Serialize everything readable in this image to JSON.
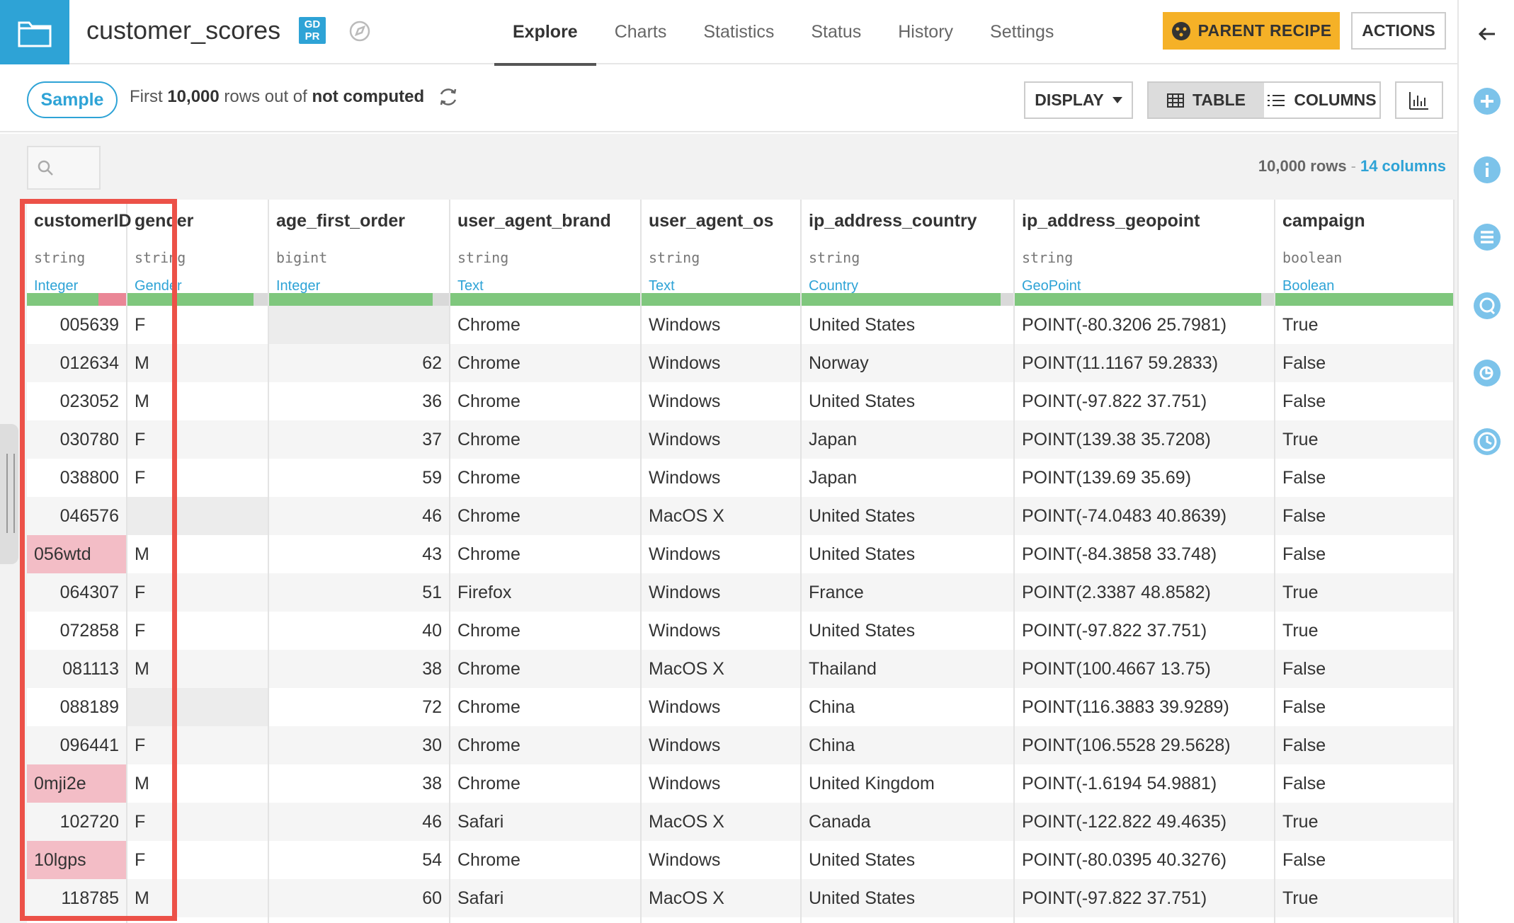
{
  "header": {
    "dataset_name": "customer_scores",
    "gdpr_badge_top": "GD",
    "gdpr_badge_bottom": "PR",
    "tabs": [
      {
        "label": "Explore",
        "active": true
      },
      {
        "label": "Charts",
        "active": false
      },
      {
        "label": "Statistics",
        "active": false
      },
      {
        "label": "Status",
        "active": false
      },
      {
        "label": "History",
        "active": false
      },
      {
        "label": "Settings",
        "active": false
      }
    ],
    "parent_recipe_label": "PARENT RECIPE",
    "actions_label": "ACTIONS"
  },
  "sample_bar": {
    "sample_label": "Sample",
    "text_prefix": "First",
    "row_limit": "10,000",
    "text_middle": "rows out of",
    "text_status": "not computed",
    "display_label": "DISPLAY",
    "table_label": "TABLE",
    "columns_label": "COLUMNS"
  },
  "summary": {
    "rows": "10,000 rows",
    "separator": "-",
    "columns": "14 columns"
  },
  "colors": {
    "accent": "#2ea3d6",
    "parent_recipe": "#f5b127",
    "valid": "#7fc77d",
    "invalid": "#ea8696",
    "highlight": "#ec5148"
  },
  "columns": [
    {
      "name": "customerID",
      "type": "string",
      "meaning": "Integer",
      "align": "right",
      "quality": {
        "ok": 72,
        "bad": 28,
        "empty": 0
      },
      "values": [
        "005639",
        "012634",
        "023052",
        "030780",
        "038800",
        "046576",
        "056wtd",
        "064307",
        "072858",
        "081113",
        "088189",
        "096441",
        "0mji2e",
        "102720",
        "10lgps",
        "118785"
      ],
      "invalid": [
        6,
        12,
        14
      ]
    },
    {
      "name": "gender",
      "type": "string",
      "meaning": "Gender",
      "align": "left",
      "quality": {
        "ok": 90,
        "bad": 0,
        "empty": 10
      },
      "values": [
        "F",
        "M",
        "M",
        "F",
        "F",
        "",
        "M",
        "F",
        "F",
        "M",
        "",
        "F",
        "M",
        "F",
        "F",
        "M"
      ],
      "invalid": []
    },
    {
      "name": "age_first_order",
      "type": "bigint",
      "meaning": "Integer",
      "align": "right",
      "quality": {
        "ok": 91,
        "bad": 0,
        "empty": 9
      },
      "values": [
        "",
        "62",
        "36",
        "37",
        "59",
        "46",
        "43",
        "51",
        "40",
        "38",
        "72",
        "30",
        "38",
        "46",
        "54",
        "60"
      ],
      "invalid": []
    },
    {
      "name": "user_agent_brand",
      "type": "string",
      "meaning": "Text",
      "align": "left",
      "quality": {
        "ok": 100,
        "bad": 0,
        "empty": 0
      },
      "values": [
        "Chrome",
        "Chrome",
        "Chrome",
        "Chrome",
        "Chrome",
        "Chrome",
        "Chrome",
        "Firefox",
        "Chrome",
        "Chrome",
        "Chrome",
        "Chrome",
        "Chrome",
        "Safari",
        "Chrome",
        "Safari"
      ],
      "invalid": []
    },
    {
      "name": "user_agent_os",
      "type": "string",
      "meaning": "Text",
      "align": "left",
      "quality": {
        "ok": 100,
        "bad": 0,
        "empty": 0
      },
      "values": [
        "Windows",
        "Windows",
        "Windows",
        "Windows",
        "Windows",
        "MacOS X",
        "Windows",
        "Windows",
        "Windows",
        "MacOS X",
        "Windows",
        "Windows",
        "Windows",
        "MacOS X",
        "Windows",
        "MacOS X"
      ],
      "invalid": []
    },
    {
      "name": "ip_address_country",
      "type": "string",
      "meaning": "Country",
      "align": "left",
      "quality": {
        "ok": 94,
        "bad": 0,
        "empty": 6
      },
      "values": [
        "United States",
        "Norway",
        "United States",
        "Japan",
        "Japan",
        "United States",
        "United States",
        "France",
        "United States",
        "Thailand",
        "China",
        "China",
        "United Kingdom",
        "Canada",
        "United States",
        "United States"
      ],
      "invalid": []
    },
    {
      "name": "ip_address_geopoint",
      "type": "string",
      "meaning": "GeoPoint",
      "align": "left",
      "quality": {
        "ok": 95,
        "bad": 0,
        "empty": 5
      },
      "values": [
        "POINT(-80.3206 25.7981)",
        "POINT(11.1167 59.2833)",
        "POINT(-97.822 37.751)",
        "POINT(139.38 35.7208)",
        "POINT(139.69 35.69)",
        "POINT(-74.0483 40.8639)",
        "POINT(-84.3858 33.748)",
        "POINT(2.3387 48.8582)",
        "POINT(-97.822 37.751)",
        "POINT(100.4667 13.75)",
        "POINT(116.3883 39.9289)",
        "POINT(106.5528 29.5628)",
        "POINT(-1.6194 54.9881)",
        "POINT(-122.822 49.4635)",
        "POINT(-80.0395 40.3276)",
        "POINT(-97.822 37.751)"
      ],
      "invalid": []
    },
    {
      "name": "campaign",
      "type": "boolean",
      "meaning": "Boolean",
      "align": "left",
      "quality": {
        "ok": 100,
        "bad": 0,
        "empty": 0
      },
      "values": [
        "True",
        "False",
        "False",
        "True",
        "False",
        "False",
        "False",
        "True",
        "True",
        "False",
        "False",
        "False",
        "False",
        "True",
        "False",
        "True"
      ],
      "invalid": []
    }
  ]
}
